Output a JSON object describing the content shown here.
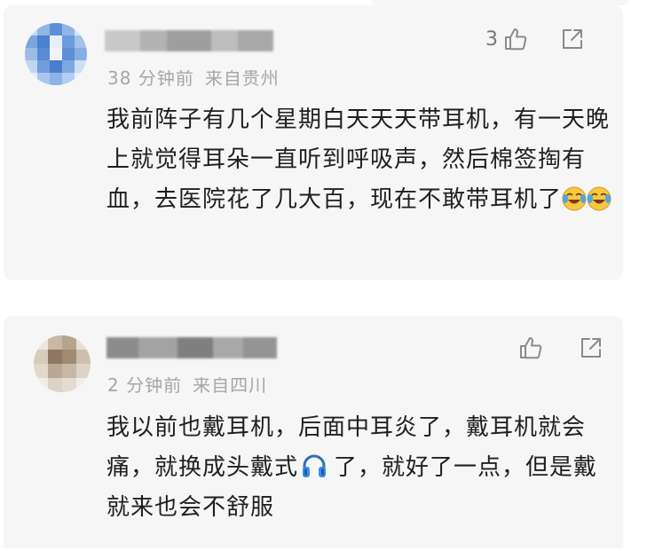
{
  "comments": [
    {
      "time": "38 分钟前",
      "location": "来自贵州",
      "likes": "3",
      "text_before_emoji": "我前阵子有几个星期白天天天带耳机，有一天晚上就觉得耳朵一直听到呼吸声，然后棉签掏有血，去医院花了几大百，现在不敢带耳机了",
      "emoji": [
        "crying-laughing-emoji",
        "crying-laughing-emoji"
      ]
    },
    {
      "time": "2 分钟前",
      "location": "来自四川",
      "likes": "",
      "text_before_emoji": "我以前也戴耳机，后面中耳炎了，戴耳机就会痛，就换成头戴式",
      "emoji": [
        "headphone-emoji"
      ],
      "text_after_emoji": "了，就好了一点，但是戴就来也会不舒服"
    }
  ],
  "colors": {
    "card_bg": "#f6f6f6",
    "text": "#1f1f1f",
    "meta": "#a6a6a6",
    "icon": "#8a8a8a",
    "headphone_blue": "#3a8ee6"
  }
}
